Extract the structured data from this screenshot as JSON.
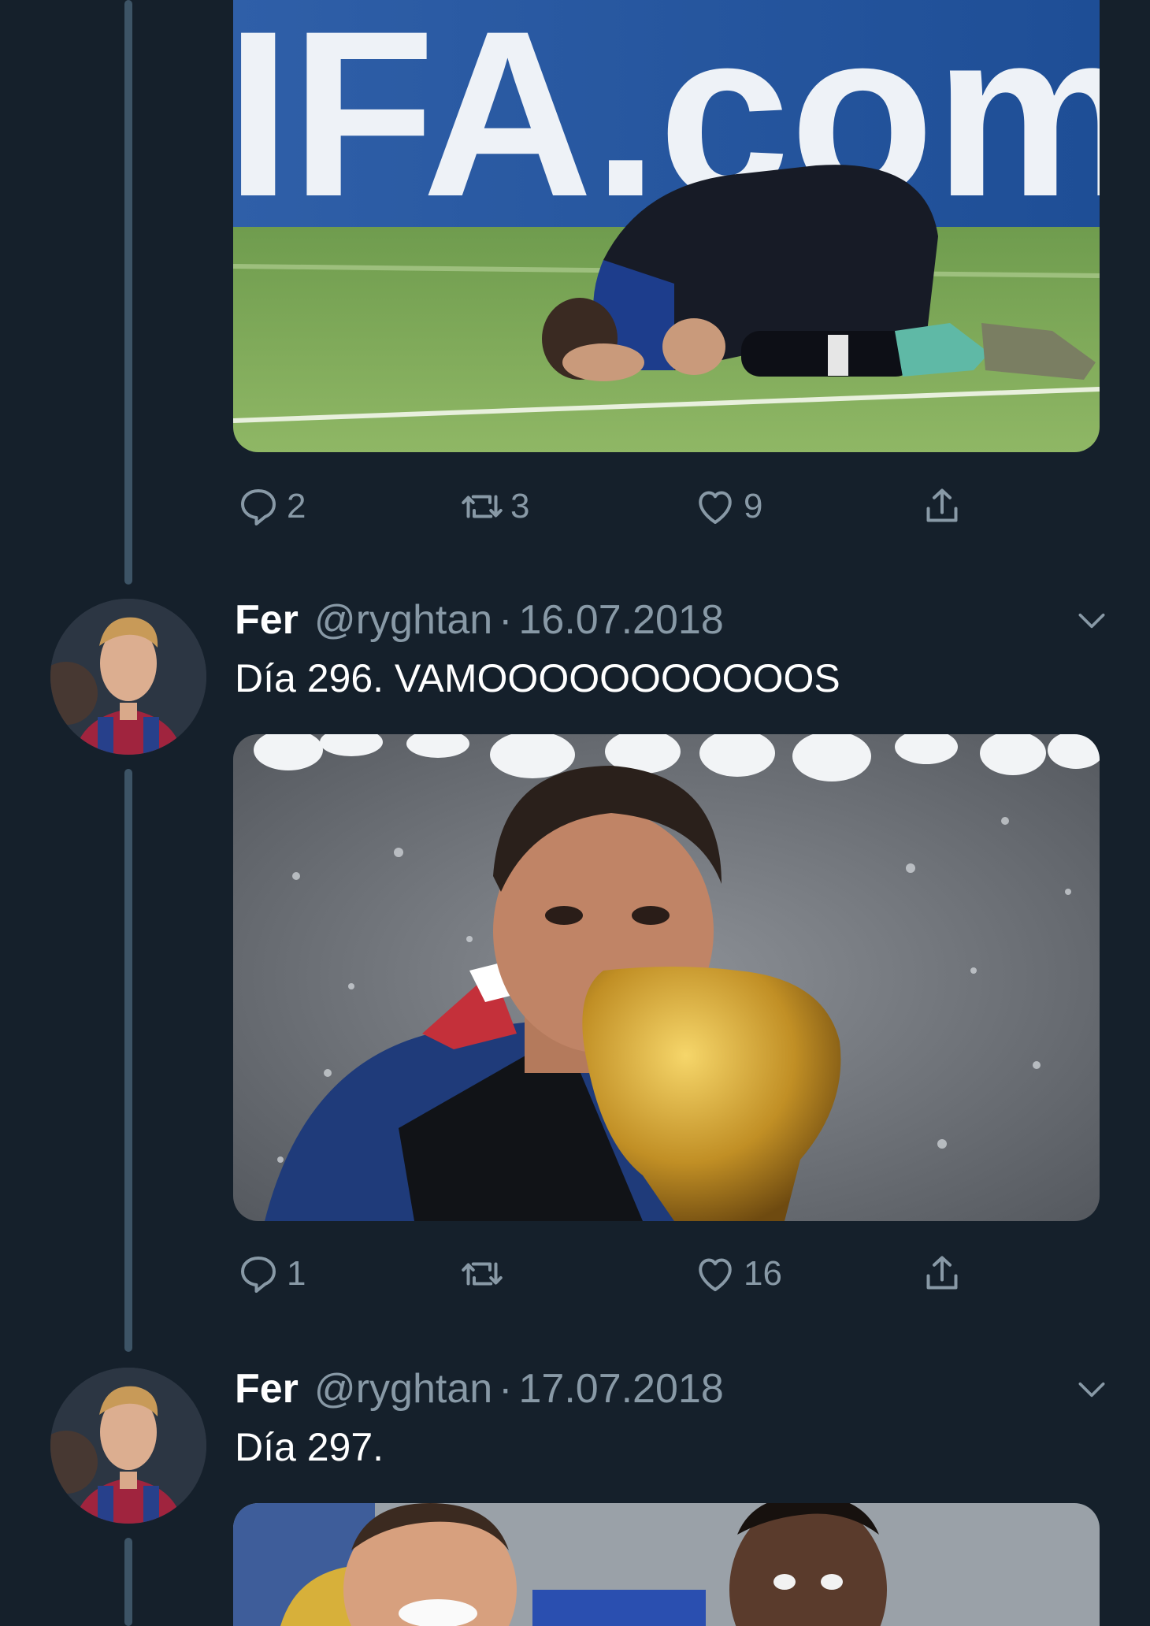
{
  "tweets": [
    {
      "actions": {
        "reply": "2",
        "retweet": "3",
        "like": "9"
      }
    },
    {
      "name": "Fer",
      "handle": "@ryghtan",
      "dot": "·",
      "date": "16.07.2018",
      "text": "Día 296. VAMOOOOOOOOOOOS",
      "actions": {
        "reply": "1",
        "retweet": "",
        "like": "16"
      }
    },
    {
      "name": "Fer",
      "handle": "@ryghtan",
      "dot": "·",
      "date": "17.07.2018",
      "text": "Día 297."
    }
  ],
  "media_text": {
    "banner": "IFA.com"
  },
  "icons": {
    "reply": "reply-icon",
    "retweet": "retweet-icon",
    "like": "heart-icon",
    "share": "share-icon",
    "more": "chevron-down-icon"
  },
  "colors": {
    "background": "#15202b",
    "secondary_text": "#8899a6",
    "thread_line": "#3d5466"
  }
}
